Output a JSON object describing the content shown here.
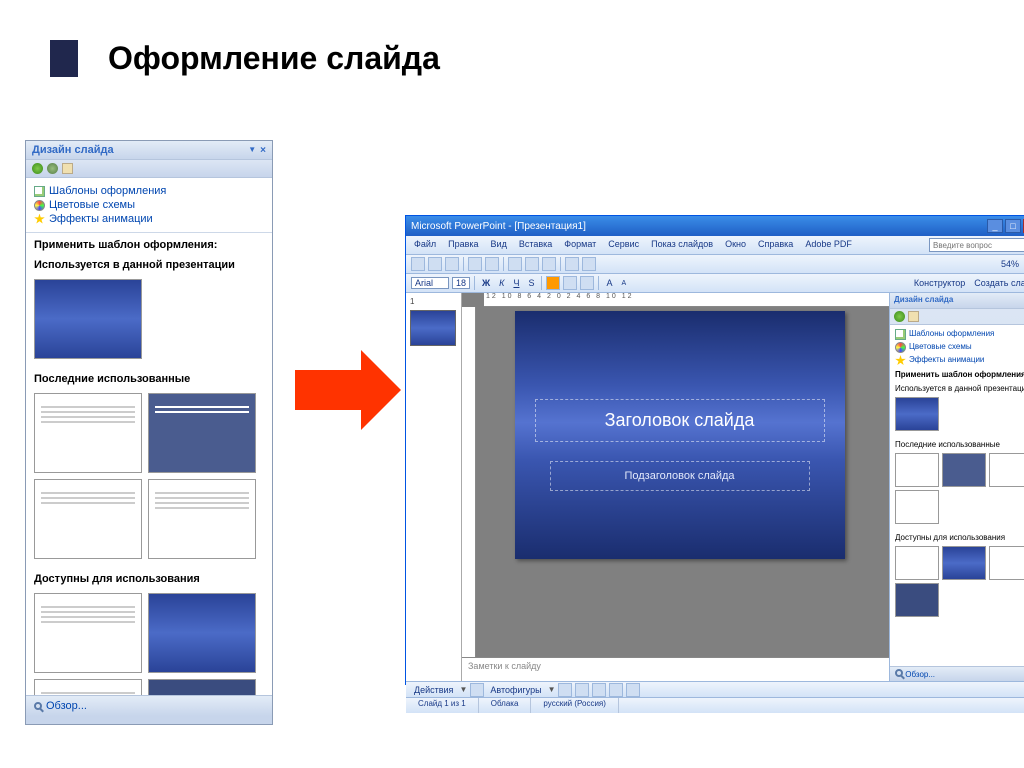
{
  "page_title": "Оформление слайда",
  "taskpane": {
    "title": "Дизайн слайда",
    "links": {
      "templates": "Шаблоны оформления",
      "colors": "Цветовые схемы",
      "effects": "Эффекты анимации"
    },
    "apply_label": "Применить шаблон оформления:",
    "section_used": "Используется в данной презентации",
    "section_recent": "Последние использованные",
    "section_avail": "Доступны для использования",
    "browse": "Обзор..."
  },
  "app": {
    "title": "Microsoft PowerPoint - [Презентация1]",
    "ask": "Введите вопрос",
    "menu": [
      "Файл",
      "Правка",
      "Вид",
      "Вставка",
      "Формат",
      "Сервис",
      "Показ слайдов",
      "Окно",
      "Справка",
      "Adobe PDF"
    ],
    "font": "Arial",
    "fontsize": "18",
    "zoom": "54%",
    "btn_designer": "Конструктор",
    "btn_newslide": "Создать слайд",
    "ruler": "12 10 8 6 4 2 0 2 4 6 8 10 12",
    "slide_num": "1",
    "slide_title": "Заголовок слайда",
    "slide_subtitle": "Подзаголовок слайда",
    "notes": "Заметки к слайду",
    "draw_actions": "Действия",
    "draw_autoshapes": "Автофигуры",
    "status_slide": "Слайд 1 из 1",
    "status_theme": "Облака",
    "status_lang": "русский (Россия)"
  },
  "sidepane": {
    "title": "Дизайн слайда",
    "templates": "Шаблоны оформления",
    "colors": "Цветовые схемы",
    "effects": "Эффекты анимации",
    "apply": "Применить шаблон оформления:",
    "used": "Используется в данной презентации",
    "recent": "Последние использованные",
    "avail": "Доступны для использования",
    "browse": "Обзор..."
  }
}
